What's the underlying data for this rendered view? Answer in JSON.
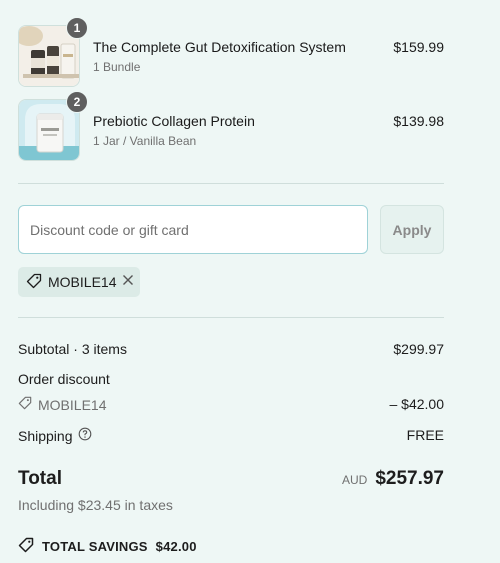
{
  "items": [
    {
      "quantity": "1",
      "title": "The Complete Gut Detoxification System",
      "variant": "1 Bundle",
      "price": "$159.99"
    },
    {
      "quantity": "2",
      "title": "Prebiotic Collagen Protein",
      "variant": "1 Jar / Vanilla Bean",
      "price": "$139.98"
    }
  ],
  "discount": {
    "placeholder": "Discount code or gift card",
    "apply_label": "Apply",
    "applied_code": "MOBILE14"
  },
  "summary": {
    "subtotal_label": "Subtotal · 3 items",
    "subtotal_value": "$299.97",
    "order_discount_label": "Order discount",
    "discount_code": "MOBILE14",
    "discount_value": "– $42.00",
    "shipping_label": "Shipping",
    "shipping_value": "FREE",
    "total_label": "Total",
    "currency": "AUD",
    "total_value": "$257.97",
    "tax_note": "Including $23.45 in taxes",
    "savings_label": "TOTAL SAVINGS",
    "savings_value": "$42.00"
  },
  "icons": {
    "tag": "tag-icon",
    "remove": "close-icon",
    "help": "help-circle-icon"
  },
  "colors": {
    "background": "#eef7f5",
    "input_border": "#9fd2d7",
    "badge": "#5f5f5f"
  }
}
